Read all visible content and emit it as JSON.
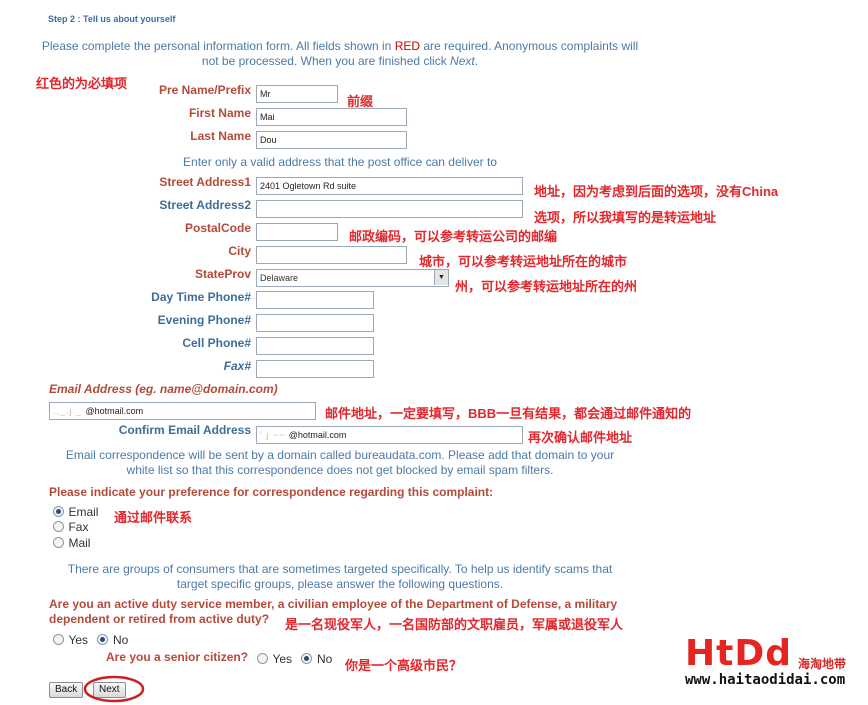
{
  "step_title": "Step 2 : Tell us about yourself",
  "intro": {
    "part1": "Please complete the personal information form. All fields shown in ",
    "red_word": "RED",
    "part2": " are required. Anonymous complaints will not be processed. When you are finished click ",
    "next_word": "Next",
    "end": "."
  },
  "notes": {
    "required_hint": "红色的为必填项",
    "prefix_hint": "前缀",
    "address_hint_1": "地址，因为考虑到后面的选项，没有China",
    "address_hint_2": "选项，所以我填写的是转运地址",
    "postal_hint": "邮政编码，可以参考转运公司的邮编",
    "city_hint": "城市，可以参考转运地址所在的城市",
    "state_hint": "州，可以参考转运地址所在的州",
    "email_hint": "邮件地址，一定要填写，BBB一旦有结果，都会通过邮件通知的",
    "confirm_hint": "再次确认邮件地址",
    "contact_hint": "通过邮件联系",
    "military_hint": "是一名现役军人，一名国防部的文职雇员，军属或退役军人",
    "senior_hint": "你是一个高级市民？"
  },
  "form": {
    "prefix": {
      "label": "Pre Name/Prefix",
      "value": "Mr"
    },
    "first_name": {
      "label": "First Name",
      "value": "Mai"
    },
    "last_name": {
      "label": "Last Name",
      "value": "Dou"
    },
    "address_note": "Enter only a valid address that the post office can deliver to",
    "street1": {
      "label": "Street Address1",
      "value": "2401 Ogletown Rd suite"
    },
    "street2": {
      "label": "Street Address2",
      "value": ""
    },
    "postal": {
      "label": "PostalCode",
      "value": ""
    },
    "city": {
      "label": "City",
      "value": ""
    },
    "state": {
      "label": "StateProv",
      "value": "Delaware"
    },
    "day_phone": {
      "label": "Day Time Phone#",
      "value": ""
    },
    "evening_phone": {
      "label": "Evening Phone#",
      "value": ""
    },
    "cell_phone": {
      "label": "Cell Phone#",
      "value": ""
    },
    "fax": {
      "label": "Fax#",
      "value": ""
    },
    "email": {
      "label": "Email Address (eg. name@domain.com)",
      "value": "@hotmail.com"
    },
    "confirm_email": {
      "label": "Confirm Email Address",
      "value": "@hotmail.com"
    },
    "email_note": "Email correspondence will be sent by a domain called bureaudata.com. Please add that domain to your white list so that this correspondence does not get blocked by email spam filters."
  },
  "correspondence": {
    "question": "Please indicate your preference for correspondence regarding this complaint:",
    "options": [
      "Email",
      "Fax",
      "Mail"
    ],
    "selected": "Email"
  },
  "groups_note": "There are groups of consumers that are sometimes targeted specifically. To help us identify scams that target specific groups, please answer the following questions.",
  "military": {
    "question": "Are you an active duty service member, a civilian employee of the Department of Defense, a military dependent or retired from active duty?",
    "yes": "Yes",
    "no": "No",
    "selected": "No"
  },
  "senior": {
    "question": "Are you a senior citizen?",
    "yes": "Yes",
    "no": "No",
    "selected": "No"
  },
  "buttons": {
    "back": "Back",
    "next": "Next"
  },
  "watermark": {
    "brand": "HtDd",
    "brand_sub": "海淘地带",
    "url": "www.haitaodidai.com"
  },
  "colors": {
    "required_label": "#b54a3a",
    "optional_label": "#3e6d9a",
    "annotation": "#e0282e",
    "logo": "#e52521"
  }
}
